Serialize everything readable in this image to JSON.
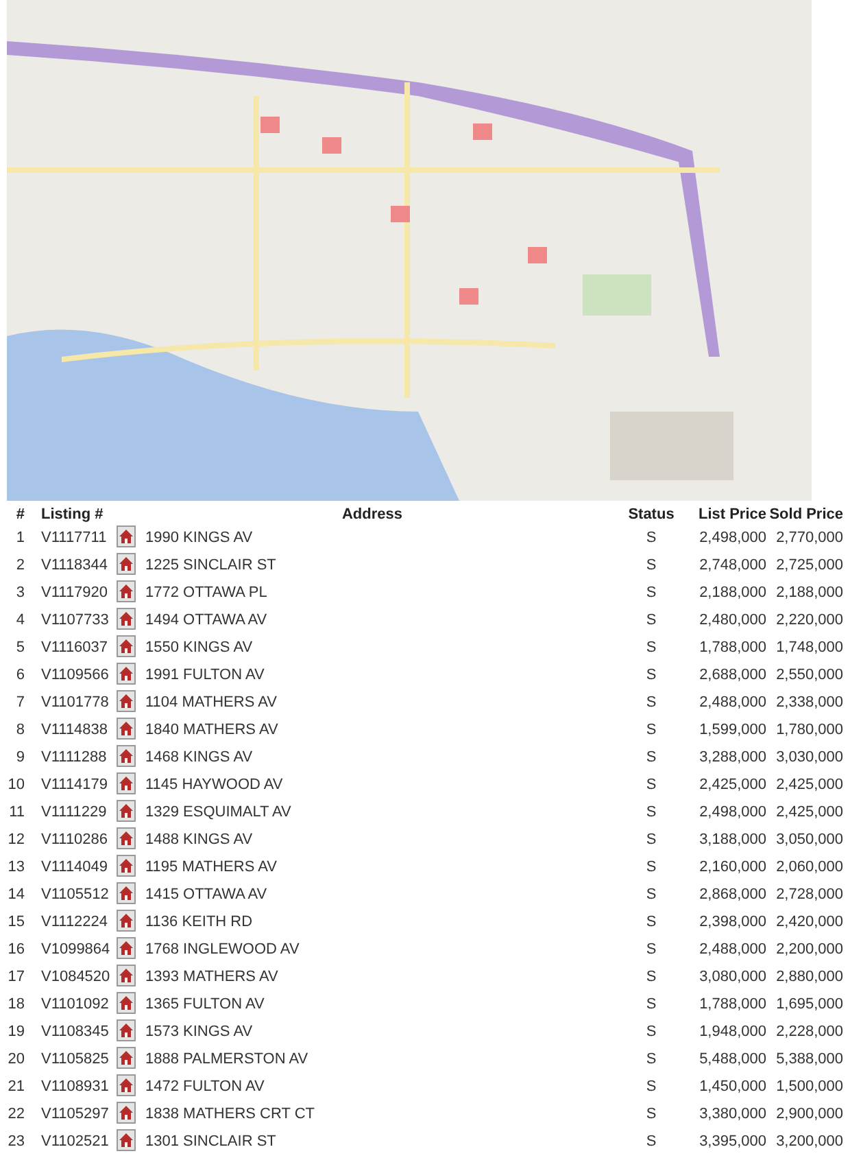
{
  "table": {
    "columns": [
      "#",
      "Listing #",
      "Address",
      "Status",
      "List Price",
      "Sold Price"
    ],
    "rows": [
      [
        "1",
        "V1117711",
        "1990 KINGS AV",
        "S",
        "2,498,000",
        "2,770,000"
      ],
      [
        "2",
        "V1118344",
        "1225 SINCLAIR ST",
        "S",
        "2,748,000",
        "2,725,000"
      ],
      [
        "3",
        "V1117920",
        "1772 OTTAWA PL",
        "S",
        "2,188,000",
        "2,188,000"
      ],
      [
        "4",
        "V1107733",
        "1494 OTTAWA AV",
        "S",
        "2,480,000",
        "2,220,000"
      ],
      [
        "5",
        "V1116037",
        "1550 KINGS AV",
        "S",
        "1,788,000",
        "1,748,000"
      ],
      [
        "6",
        "V1109566",
        "1991 FULTON AV",
        "S",
        "2,688,000",
        "2,550,000"
      ],
      [
        "7",
        "V1101778",
        "1104 MATHERS AV",
        "S",
        "2,488,000",
        "2,338,000"
      ],
      [
        "8",
        "V1114838",
        "1840 MATHERS AV",
        "S",
        "1,599,000",
        "1,780,000"
      ],
      [
        "9",
        "V1111288",
        "1468 KINGS AV",
        "S",
        "3,288,000",
        "3,030,000"
      ],
      [
        "10",
        "V1114179",
        "1145 HAYWOOD AV",
        "S",
        "2,425,000",
        "2,425,000"
      ],
      [
        "11",
        "V1111229",
        "1329 ESQUIMALT AV",
        "S",
        "2,498,000",
        "2,425,000"
      ],
      [
        "12",
        "V1110286",
        "1488 KINGS AV",
        "S",
        "3,188,000",
        "3,050,000"
      ],
      [
        "13",
        "V1114049",
        "1195 MATHERS AV",
        "S",
        "2,160,000",
        "2,060,000"
      ],
      [
        "14",
        "V1105512",
        "1415 OTTAWA AV",
        "S",
        "2,868,000",
        "2,728,000"
      ],
      [
        "15",
        "V1112224",
        "1136 KEITH RD",
        "S",
        "2,398,000",
        "2,420,000"
      ],
      [
        "16",
        "V1099864",
        "1768 INGLEWOOD AV",
        "S",
        "2,488,000",
        "2,200,000"
      ],
      [
        "17",
        "V1084520",
        "1393 MATHERS AV",
        "S",
        "3,080,000",
        "2,880,000"
      ],
      [
        "18",
        "V1101092",
        "1365 FULTON AV",
        "S",
        "1,788,000",
        "1,695,000"
      ],
      [
        "19",
        "V1108345",
        "1573 KINGS AV",
        "S",
        "1,948,000",
        "2,228,000"
      ],
      [
        "20",
        "V1105825",
        "1888 PALMERSTON AV",
        "S",
        "5,488,000",
        "5,388,000"
      ],
      [
        "21",
        "V1108931",
        "1472 FULTON AV",
        "S",
        "1,450,000",
        "1,500,000"
      ],
      [
        "22",
        "V1105297",
        "1838 MATHERS CRT CT",
        "S",
        "3,380,000",
        "2,900,000"
      ],
      [
        "23",
        "V1102521",
        "1301 SINCLAIR ST",
        "S",
        "3,395,000",
        "3,200,000"
      ]
    ]
  }
}
